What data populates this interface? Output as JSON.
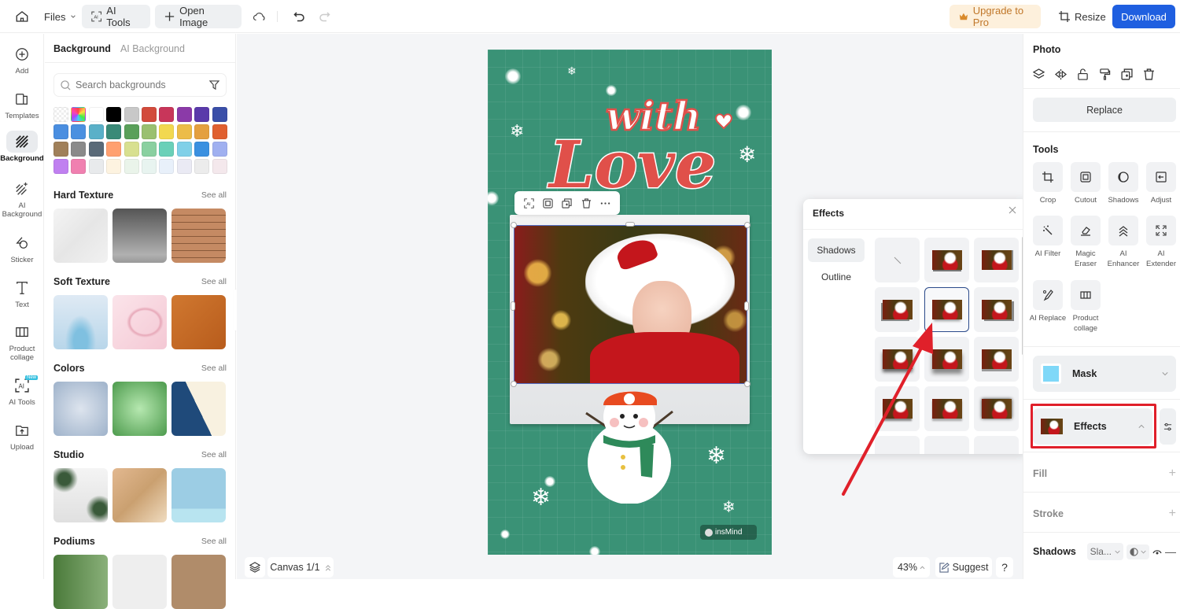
{
  "topbar": {
    "files_label": "Files",
    "ai_tools_label": "AI Tools",
    "open_image_label": "Open Image",
    "upgrade_label": "Upgrade to Pro",
    "resize_label": "Resize",
    "download_label": "Download"
  },
  "rail": {
    "items": [
      {
        "label": "Add",
        "icon": "plus-circle-icon"
      },
      {
        "label": "Templates",
        "icon": "templates-icon"
      },
      {
        "label": "Background",
        "icon": "background-icon",
        "active": true
      },
      {
        "label": "AI Background",
        "icon": "ai-background-icon"
      },
      {
        "label": "Sticker",
        "icon": "sticker-icon"
      },
      {
        "label": "Text",
        "icon": "text-icon"
      },
      {
        "label": "Product collage",
        "icon": "product-collage-icon"
      },
      {
        "label": "AI Tools",
        "icon": "ai-tools-icon",
        "badge": "New"
      },
      {
        "label": "Upload",
        "icon": "upload-icon"
      }
    ]
  },
  "bg_panel": {
    "tabs": [
      "Background",
      "AI Background"
    ],
    "active_tab": "Background",
    "search_placeholder": "Search backgrounds",
    "swatches": [
      "#f4f4f4",
      "#rainbow",
      "#ffffff",
      "#000000",
      "#c8c8c8",
      "#d24b3c",
      "#c8365a",
      "#8b3aa8",
      "#5a3aaa",
      "#3a4fa8",
      "#4a8ee0",
      "#4a90e0",
      "#5ab0c8",
      "#3a8a78",
      "#5aa05a",
      "#9ac070",
      "#f2d850",
      "#ecbc48",
      "#e4a040",
      "#e06030",
      "#a0805a",
      "#8a8a8a",
      "#5a6a78",
      "#ffa070",
      "#d8e090",
      "#8ad0a0",
      "#6ad0b8",
      "#80d0e8",
      "#3a90e0",
      "#a0b0f0",
      "#c080f0",
      "#f080b0",
      "#e8eaec",
      "#fdf3e0",
      "#eaf4ea",
      "#e8f4f0",
      "#e8f0fa",
      "#eaeaf4",
      "#ececec",
      "#f4e8ec"
    ],
    "sections": [
      {
        "title": "Hard Texture",
        "see_all": "See all"
      },
      {
        "title": "Soft Texture",
        "see_all": "See all"
      },
      {
        "title": "Colors",
        "see_all": "See all"
      },
      {
        "title": "Studio",
        "see_all": "See all"
      },
      {
        "title": "Podiums",
        "see_all": "See all"
      }
    ]
  },
  "canvas": {
    "poster_text_top": "with",
    "poster_text_main": "Love",
    "watermark": "insMind",
    "canvas_label": "Canvas 1/1",
    "zoom_level": "43%",
    "suggest_label": "Suggest",
    "help_label": "?"
  },
  "effects_popover": {
    "title": "Effects",
    "tabs": [
      "Shadows",
      "Outline"
    ],
    "active_tab": "Shadows",
    "selected_index": 4
  },
  "right_panel": {
    "photo_heading": "Photo",
    "replace_label": "Replace",
    "tools_heading": "Tools",
    "tools": [
      {
        "label": "Crop",
        "icon": "crop-icon"
      },
      {
        "label": "Cutout",
        "icon": "cutout-icon"
      },
      {
        "label": "Shadows",
        "icon": "shadows-icon"
      },
      {
        "label": "Adjust",
        "icon": "adjust-icon"
      },
      {
        "label": "AI Filter",
        "icon": "ai-filter-icon"
      },
      {
        "label": "Magic Eraser",
        "icon": "eraser-icon"
      },
      {
        "label": "AI Enhancer",
        "icon": "enhancer-icon"
      },
      {
        "label": "AI Extender",
        "icon": "extender-icon"
      },
      {
        "label": "AI Replace",
        "icon": "ai-replace-icon"
      },
      {
        "label": "Product collage",
        "icon": "product-collage-icon"
      }
    ],
    "mask_label": "Mask",
    "mask_color": "#7fd8f8",
    "effects_label": "Effects",
    "fill_label": "Fill",
    "stroke_label": "Stroke",
    "shadows_label": "Shadows",
    "shadows_select": "Sla..."
  },
  "colors": {
    "accent": "#1f5fe0",
    "poster_green": "#3a9276",
    "love_red": "#e0504a",
    "highlight_red": "#e01f2a"
  }
}
